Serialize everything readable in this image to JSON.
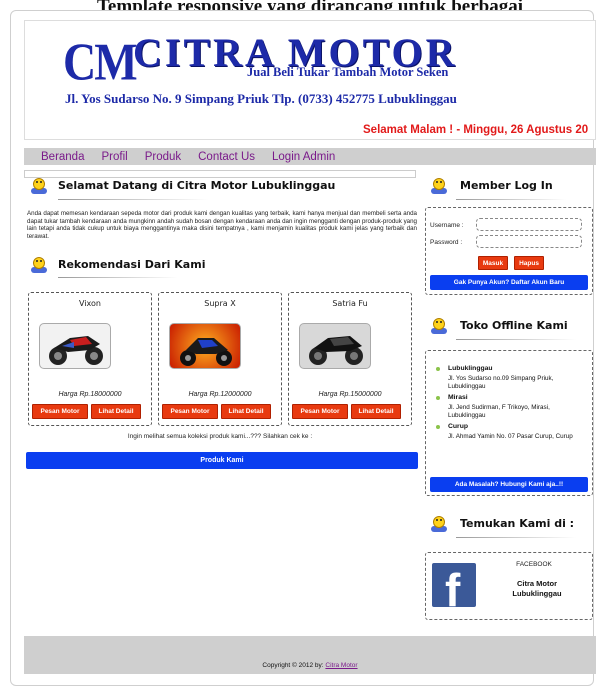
{
  "top_strip_text": "Template responsive yang dirancang untuk berbagai",
  "header": {
    "logo_mark": "CM",
    "title": "CITRA MOTOR",
    "subtitle": "Jual Beli Tukar Tambah Motor Seken",
    "address": "Jl. Yos Sudarso No. 9 Simpang Priuk Tlp. (0733) 452775 Lubuklinggau",
    "greeting": "Selamat Malam ! - Minggu, 26 Agustus 20"
  },
  "nav": {
    "items": [
      "Beranda",
      "Profil",
      "Produk",
      "Contact Us",
      "Login Admin"
    ]
  },
  "main": {
    "welcome_heading": "Selamat Datang di Citra Motor Lubuklinggau",
    "intro_text": "Anda dapat memesan kendaraan sepeda motor dari produk kami dengan kualitas yang terbaik, kami hanya menjual dan membeli serta anda dapat tukar tambah kendaraan anda mungkinn andah sudah bosan dengan kendaraan anda dan ingin mengganti dengan produk-produk yang lain tetapi anda tidak cukup untuk biaya menggantinya maka disini tempatnya , kami menjamin kualitas produk kami jelas yang terbaik dan terawat.",
    "recommend_heading": "Rekomendasi Dari Kami",
    "products": [
      {
        "name": "Vixon",
        "price": "Harga Rp.18000000",
        "order_label": "Pesan Motor",
        "detail_label": "Lihat Detail"
      },
      {
        "name": "Supra X",
        "price": "Harga Rp.12000000",
        "order_label": "Pesan Motor",
        "detail_label": "Lihat Detail"
      },
      {
        "name": "Satria Fu",
        "price": "Harga Rp.15000000",
        "order_label": "Pesan Motor",
        "detail_label": "Lihat Detail"
      }
    ],
    "collection_text": "Ingin melihat semua koleksi produk kami...??? Silahkan cek ke :",
    "products_button": "Produk Kami"
  },
  "sidebar": {
    "member_heading": "Member Log In",
    "username_label": "Username :",
    "password_label": "Password :",
    "login_button": "Masuk",
    "reset_button": "Hapus",
    "register_button": "Gak Punya Akun? Daftar Akun Baru",
    "stores_heading": "Toko Offline Kami",
    "stores": [
      {
        "name": "Lubuklinggau",
        "address": "Jl. Yos Sudarso no.09 Simpang Priuk, Lubuklinggau"
      },
      {
        "name": "Mirasi",
        "address": "Jl. Jend Sudirman, F Trikoyo, Mirasi, Lubuklinggau"
      },
      {
        "name": "Curup",
        "address": "Jl. Ahmad Yamin No. 07 Pasar Curup, Curup"
      }
    ],
    "contact_button": "Ada Masalah? Hubungi Kami aja..!!",
    "find_heading": "Temukan Kami di :",
    "facebook_label": "FACEBOOK",
    "facebook_name": "Citra Motor Lubuklinggau"
  },
  "footer": {
    "copyright": "Copyright © 2012 by:",
    "link": "Citra Motor"
  },
  "colors": {
    "brand_blue": "#1d2aa8",
    "nav_bg": "#cfcfcf",
    "nav_link": "#7a1a8a",
    "greeting_red": "#e21a1a",
    "action_red": "#e83a10",
    "action_blue": "#0a3ef0"
  }
}
